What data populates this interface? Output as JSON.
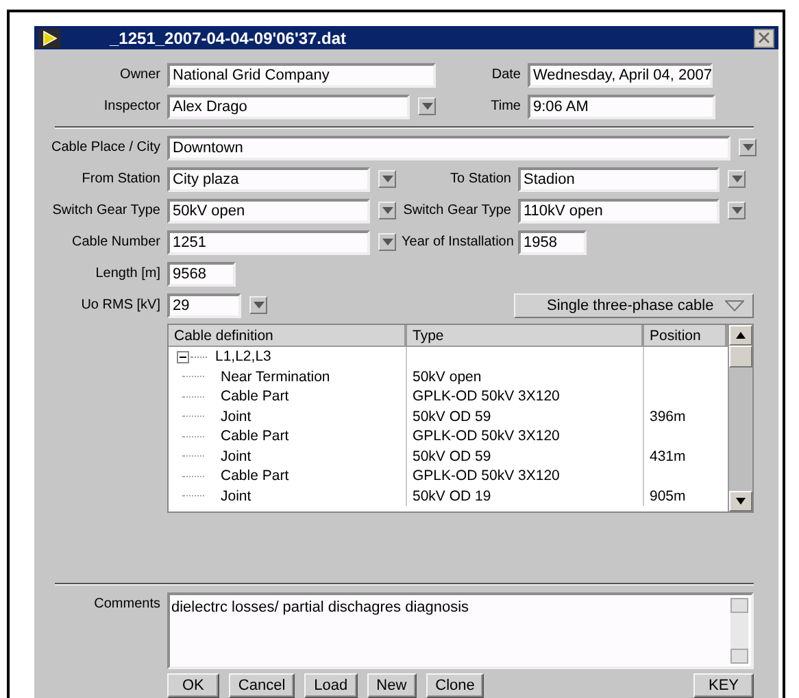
{
  "window": {
    "title": "_1251_2007-04-04-09'06'37.dat"
  },
  "header_rows": [
    {
      "left": {
        "label": "Owner",
        "value": "National Grid Company",
        "dropdown": false
      },
      "right": {
        "label": "Date",
        "value": "Wednesday, April 04, 2007",
        "dropdown": false
      }
    },
    {
      "left": {
        "label": "Inspector",
        "value": "Alex Drago",
        "dropdown": true
      },
      "right": {
        "label": "Time",
        "value": "9:06 AM",
        "dropdown": false
      }
    }
  ],
  "cable_place": {
    "label": "Cable Place / City",
    "value": "Downtown",
    "dropdown": true
  },
  "cable_rows": [
    {
      "left": {
        "label": "From Station",
        "value": "City plaza",
        "dropdown": true
      },
      "right": {
        "label": "To Station",
        "value": "Stadion",
        "dropdown": true
      }
    },
    {
      "left": {
        "label": "Switch Gear Type",
        "value": "50kV open",
        "dropdown": true
      },
      "right": {
        "label": "Switch Gear Type",
        "value": "110kV open",
        "dropdown": true
      }
    },
    {
      "left": {
        "label": "Cable Number",
        "value": "1251",
        "dropdown": true
      },
      "right": {
        "label": "Year of Installation",
        "value": "1958",
        "dropdown": false
      }
    },
    {
      "left": {
        "label": "Length [m]",
        "value": "9568",
        "dropdown": false
      }
    },
    {
      "left": {
        "label": "Uo RMS [kV]",
        "value": "29",
        "dropdown": true
      }
    }
  ],
  "cable_type_selector": "Single three-phase cable",
  "table": {
    "columns": [
      "Cable definition",
      "Type",
      "Position"
    ],
    "tree": [
      {
        "name": "L1,L2,L3",
        "expanded": true,
        "children": [
          {
            "name": "Near Termination",
            "type": "50kV open"
          },
          {
            "name": "Cable Part",
            "type": "GPLK-OD 50kV 3X120"
          },
          {
            "name": "Joint",
            "type": "50kV OD  59",
            "position": "396m"
          },
          {
            "name": "Cable Part",
            "type": "GPLK-OD 50kV 3X120"
          },
          {
            "name": "Joint",
            "type": "50kV OD 59",
            "position": "431m"
          },
          {
            "name": "Cable Part",
            "type": "GPLK-OD 50kV 3X120"
          },
          {
            "name": "Joint",
            "type": "50kV OD 19",
            "position": "905m"
          }
        ]
      }
    ]
  },
  "comments": {
    "label": "Comments",
    "value": "dielectrc losses/ partial dischagres diagnosis"
  },
  "buttons": [
    "OK",
    "Cancel",
    "Load",
    "New",
    "Clone"
  ],
  "key_button": "KEY"
}
